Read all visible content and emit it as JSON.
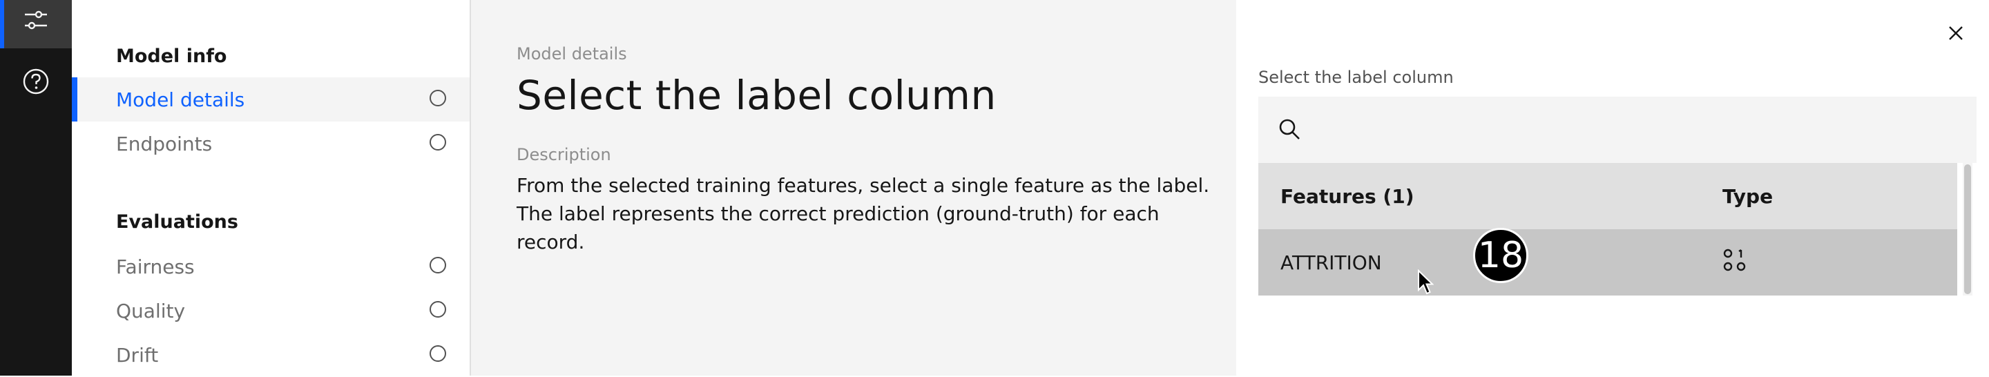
{
  "rail": {
    "active_icon": "sliders-icon",
    "help_icon": "help-icon"
  },
  "steps": {
    "model_info_title": "Model info",
    "model_info_items": [
      {
        "label": "Model details",
        "active": true
      },
      {
        "label": "Endpoints",
        "active": false
      }
    ],
    "evaluations_title": "Evaluations",
    "evaluation_items": [
      {
        "label": "Fairness"
      },
      {
        "label": "Quality"
      },
      {
        "label": "Drift"
      }
    ]
  },
  "main": {
    "breadcrumb": "Model details",
    "title": "Select the label column",
    "description_label": "Description",
    "description": "From the selected training features, select a single feature as the label. The label represents the correct prediction (ground-truth) for each record."
  },
  "side_panel": {
    "field_label": "Select the label column",
    "search_placeholder": "",
    "table": {
      "headers": [
        "Features (1)",
        "Type"
      ],
      "rows": [
        {
          "feature": "ATTRITION",
          "type_icon": "categorical-type-icon"
        }
      ]
    }
  },
  "overlay": {
    "step_badge": "18"
  },
  "colors": {
    "accent": "#0f62fe",
    "rail_bg": "#161616",
    "panel_bg": "#f4f4f4",
    "selected_row": "#c6c6c6"
  }
}
